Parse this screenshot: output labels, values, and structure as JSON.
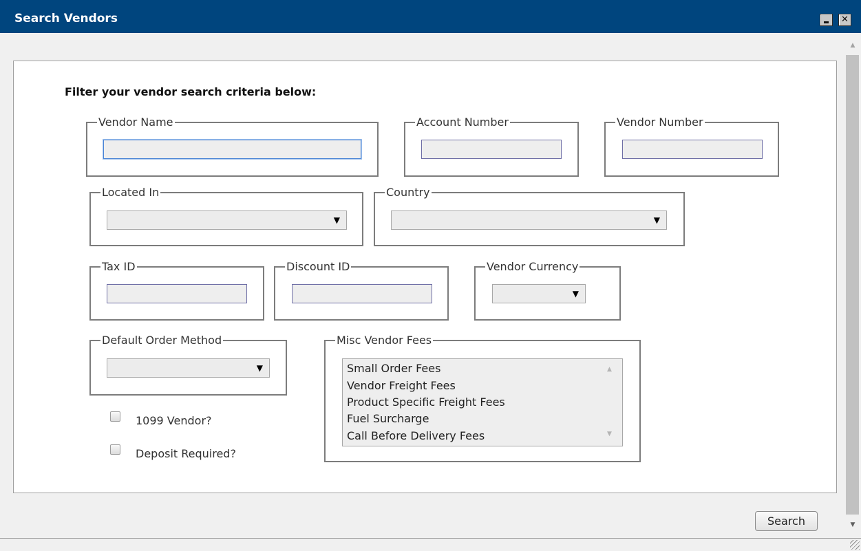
{
  "window": {
    "title": "Search Vendors"
  },
  "form": {
    "heading": "Filter your vendor search criteria below:",
    "vendor_name": {
      "label": "Vendor Name",
      "value": ""
    },
    "account_number": {
      "label": "Account Number",
      "value": ""
    },
    "vendor_number": {
      "label": "Vendor Number",
      "value": ""
    },
    "located_in": {
      "label": "Located In",
      "selected": ""
    },
    "country": {
      "label": "Country",
      "selected": ""
    },
    "tax_id": {
      "label": "Tax ID",
      "value": ""
    },
    "discount_id": {
      "label": "Discount ID",
      "value": ""
    },
    "vendor_currency": {
      "label": "Vendor Currency",
      "selected": ""
    },
    "default_order_method": {
      "label": "Default Order Method",
      "selected": ""
    },
    "vendor_1099": {
      "label": "1099 Vendor?",
      "checked": false
    },
    "deposit_required": {
      "label": "Deposit Required?",
      "checked": false
    },
    "misc_vendor_fees": {
      "label": "Misc Vendor Fees",
      "options": [
        "Small Order Fees",
        "Vendor Freight Fees",
        "Product Specific Freight Fees",
        "Fuel Surcharge",
        "Call Before Delivery Fees"
      ]
    }
  },
  "actions": {
    "search_label": "Search"
  },
  "icons": {
    "dropdown": "caret-down-icon",
    "minimize": "minimize-icon",
    "close": "close-icon"
  }
}
